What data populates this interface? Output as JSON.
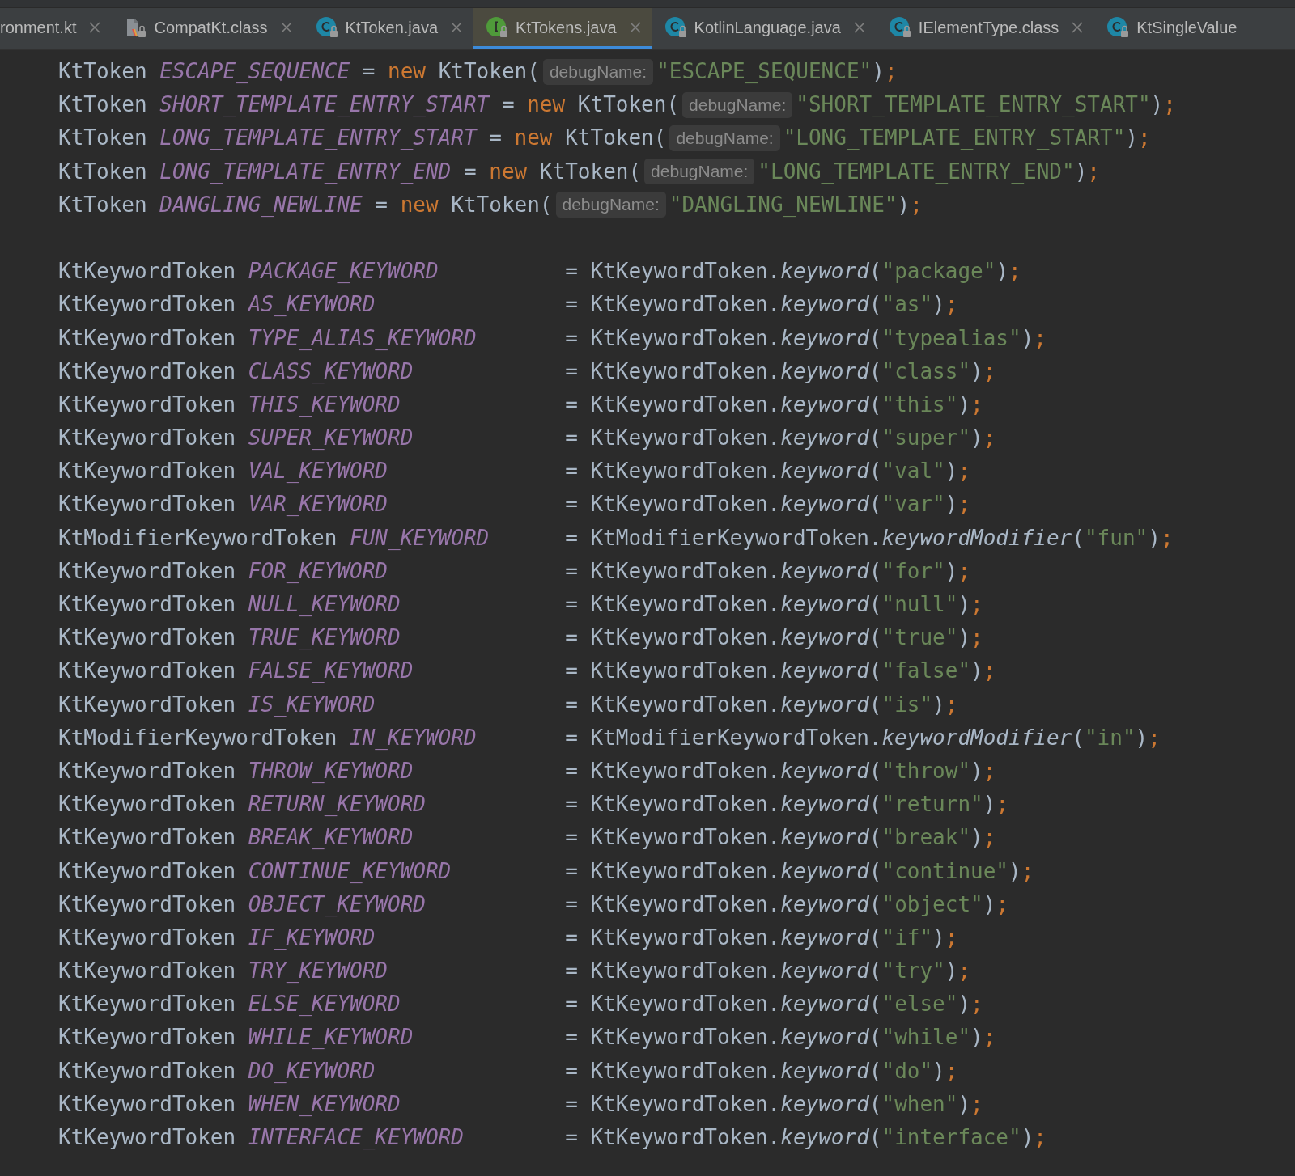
{
  "tabs": [
    {
      "label": "ronment.kt",
      "kind": "plain",
      "selected": false
    },
    {
      "label": "CompatKt.class",
      "kind": "compiled",
      "selected": false
    },
    {
      "label": "KtToken.java",
      "kind": "class",
      "selected": false
    },
    {
      "label": "KtTokens.java",
      "kind": "interface",
      "selected": true
    },
    {
      "label": "KotlinLanguage.java",
      "kind": "class",
      "selected": false
    },
    {
      "label": "IElementType.class",
      "kind": "class",
      "selected": false
    },
    {
      "label": "KtSingleValue",
      "kind": "class",
      "selected": false
    }
  ],
  "code_lines": [
    {
      "kind": "plain",
      "lhs": [
        {
          "kind": "type",
          "text": "KtToken "
        },
        {
          "kind": "field",
          "text": "ESCAPE_SEQUENCE"
        }
      ],
      "rhs": [
        {
          "kind": "op",
          "text": " = "
        },
        {
          "kind": "keyword",
          "text": "new "
        },
        {
          "kind": "type",
          "text": "KtToken("
        },
        {
          "kind": "hint",
          "text": "debugName:"
        },
        {
          "kind": "string",
          "text": "\"ESCAPE_SEQUENCE\""
        },
        {
          "kind": "type",
          "text": ")"
        },
        {
          "kind": "keyword",
          "text": ";"
        }
      ]
    },
    {
      "kind": "plain",
      "lhs": [
        {
          "kind": "type",
          "text": "KtToken "
        },
        {
          "kind": "field",
          "text": "SHORT_TEMPLATE_ENTRY_START"
        }
      ],
      "rhs": [
        {
          "kind": "op",
          "text": " = "
        },
        {
          "kind": "keyword",
          "text": "new "
        },
        {
          "kind": "type",
          "text": "KtToken("
        },
        {
          "kind": "hint",
          "text": "debugName:"
        },
        {
          "kind": "string",
          "text": "\"SHORT_TEMPLATE_ENTRY_START\""
        },
        {
          "kind": "type",
          "text": ")"
        },
        {
          "kind": "keyword",
          "text": ";"
        }
      ]
    },
    {
      "kind": "plain",
      "lhs": [
        {
          "kind": "type",
          "text": "KtToken "
        },
        {
          "kind": "field",
          "text": "LONG_TEMPLATE_ENTRY_START"
        }
      ],
      "rhs": [
        {
          "kind": "op",
          "text": " = "
        },
        {
          "kind": "keyword",
          "text": "new "
        },
        {
          "kind": "type",
          "text": "KtToken("
        },
        {
          "kind": "hint",
          "text": "debugName:"
        },
        {
          "kind": "string",
          "text": "\"LONG_TEMPLATE_ENTRY_START\""
        },
        {
          "kind": "type",
          "text": ")"
        },
        {
          "kind": "keyword",
          "text": ";"
        }
      ]
    },
    {
      "kind": "plain",
      "lhs": [
        {
          "kind": "type",
          "text": "KtToken "
        },
        {
          "kind": "field",
          "text": "LONG_TEMPLATE_ENTRY_END"
        }
      ],
      "rhs": [
        {
          "kind": "op",
          "text": " = "
        },
        {
          "kind": "keyword",
          "text": "new "
        },
        {
          "kind": "type",
          "text": "KtToken("
        },
        {
          "kind": "hint",
          "text": "debugName:"
        },
        {
          "kind": "string",
          "text": "\"LONG_TEMPLATE_ENTRY_END\""
        },
        {
          "kind": "type",
          "text": ")"
        },
        {
          "kind": "keyword",
          "text": ";"
        }
      ]
    },
    {
      "kind": "plain",
      "lhs": [
        {
          "kind": "type",
          "text": "KtToken "
        },
        {
          "kind": "field",
          "text": "DANGLING_NEWLINE"
        }
      ],
      "rhs": [
        {
          "kind": "op",
          "text": " = "
        },
        {
          "kind": "keyword",
          "text": "new "
        },
        {
          "kind": "type",
          "text": "KtToken("
        },
        {
          "kind": "hint",
          "text": "debugName:"
        },
        {
          "kind": "string",
          "text": "\"DANGLING_NEWLINE\""
        },
        {
          "kind": "type",
          "text": ")"
        },
        {
          "kind": "keyword",
          "text": ";"
        }
      ]
    },
    {
      "kind": "blank"
    },
    {
      "kind": "aligned",
      "lhs": [
        {
          "kind": "type",
          "text": "KtKeywordToken "
        },
        {
          "kind": "field",
          "text": "PACKAGE_KEYWORD"
        }
      ],
      "rhs": [
        {
          "kind": "op",
          "text": "= "
        },
        {
          "kind": "type",
          "text": "KtKeywordToken."
        },
        {
          "kind": "method",
          "text": "keyword"
        },
        {
          "kind": "type",
          "text": "("
        },
        {
          "kind": "string",
          "text": "\"package\""
        },
        {
          "kind": "type",
          "text": ")"
        },
        {
          "kind": "keyword",
          "text": ";"
        }
      ]
    },
    {
      "kind": "aligned",
      "lhs": [
        {
          "kind": "type",
          "text": "KtKeywordToken "
        },
        {
          "kind": "field",
          "text": "AS_KEYWORD"
        }
      ],
      "rhs": [
        {
          "kind": "op",
          "text": "= "
        },
        {
          "kind": "type",
          "text": "KtKeywordToken."
        },
        {
          "kind": "method",
          "text": "keyword"
        },
        {
          "kind": "type",
          "text": "("
        },
        {
          "kind": "string",
          "text": "\"as\""
        },
        {
          "kind": "type",
          "text": ")"
        },
        {
          "kind": "keyword",
          "text": ";"
        }
      ]
    },
    {
      "kind": "aligned",
      "lhs": [
        {
          "kind": "type",
          "text": "KtKeywordToken "
        },
        {
          "kind": "field",
          "text": "TYPE_ALIAS_KEYWORD"
        }
      ],
      "rhs": [
        {
          "kind": "op",
          "text": "= "
        },
        {
          "kind": "type",
          "text": "KtKeywordToken."
        },
        {
          "kind": "method",
          "text": "keyword"
        },
        {
          "kind": "type",
          "text": "("
        },
        {
          "kind": "string",
          "text": "\"typealias\""
        },
        {
          "kind": "type",
          "text": ")"
        },
        {
          "kind": "keyword",
          "text": ";"
        }
      ]
    },
    {
      "kind": "aligned",
      "lhs": [
        {
          "kind": "type",
          "text": "KtKeywordToken "
        },
        {
          "kind": "field",
          "text": "CLASS_KEYWORD"
        }
      ],
      "rhs": [
        {
          "kind": "op",
          "text": "= "
        },
        {
          "kind": "type",
          "text": "KtKeywordToken."
        },
        {
          "kind": "method",
          "text": "keyword"
        },
        {
          "kind": "type",
          "text": "("
        },
        {
          "kind": "string",
          "text": "\"class\""
        },
        {
          "kind": "type",
          "text": ")"
        },
        {
          "kind": "keyword",
          "text": ";"
        }
      ]
    },
    {
      "kind": "aligned",
      "lhs": [
        {
          "kind": "type",
          "text": "KtKeywordToken "
        },
        {
          "kind": "field",
          "text": "THIS_KEYWORD"
        }
      ],
      "rhs": [
        {
          "kind": "op",
          "text": "= "
        },
        {
          "kind": "type",
          "text": "KtKeywordToken."
        },
        {
          "kind": "method",
          "text": "keyword"
        },
        {
          "kind": "type",
          "text": "("
        },
        {
          "kind": "string",
          "text": "\"this\""
        },
        {
          "kind": "type",
          "text": ")"
        },
        {
          "kind": "keyword",
          "text": ";"
        }
      ]
    },
    {
      "kind": "aligned",
      "lhs": [
        {
          "kind": "type",
          "text": "KtKeywordToken "
        },
        {
          "kind": "field",
          "text": "SUPER_KEYWORD"
        }
      ],
      "rhs": [
        {
          "kind": "op",
          "text": "= "
        },
        {
          "kind": "type",
          "text": "KtKeywordToken."
        },
        {
          "kind": "method",
          "text": "keyword"
        },
        {
          "kind": "type",
          "text": "("
        },
        {
          "kind": "string",
          "text": "\"super\""
        },
        {
          "kind": "type",
          "text": ")"
        },
        {
          "kind": "keyword",
          "text": ";"
        }
      ]
    },
    {
      "kind": "aligned",
      "lhs": [
        {
          "kind": "type",
          "text": "KtKeywordToken "
        },
        {
          "kind": "field",
          "text": "VAL_KEYWORD"
        }
      ],
      "rhs": [
        {
          "kind": "op",
          "text": "= "
        },
        {
          "kind": "type",
          "text": "KtKeywordToken."
        },
        {
          "kind": "method",
          "text": "keyword"
        },
        {
          "kind": "type",
          "text": "("
        },
        {
          "kind": "string",
          "text": "\"val\""
        },
        {
          "kind": "type",
          "text": ")"
        },
        {
          "kind": "keyword",
          "text": ";"
        }
      ]
    },
    {
      "kind": "aligned",
      "lhs": [
        {
          "kind": "type",
          "text": "KtKeywordToken "
        },
        {
          "kind": "field",
          "text": "VAR_KEYWORD"
        }
      ],
      "rhs": [
        {
          "kind": "op",
          "text": "= "
        },
        {
          "kind": "type",
          "text": "KtKeywordToken."
        },
        {
          "kind": "method",
          "text": "keyword"
        },
        {
          "kind": "type",
          "text": "("
        },
        {
          "kind": "string",
          "text": "\"var\""
        },
        {
          "kind": "type",
          "text": ")"
        },
        {
          "kind": "keyword",
          "text": ";"
        }
      ]
    },
    {
      "kind": "aligned",
      "lhs": [
        {
          "kind": "type",
          "text": "KtModifierKeywordToken "
        },
        {
          "kind": "field",
          "text": "FUN_KEYWORD"
        }
      ],
      "rhs": [
        {
          "kind": "op",
          "text": "= "
        },
        {
          "kind": "type",
          "text": "KtModifierKeywordToken."
        },
        {
          "kind": "method",
          "text": "keywordModifier"
        },
        {
          "kind": "type",
          "text": "("
        },
        {
          "kind": "string",
          "text": "\"fun\""
        },
        {
          "kind": "type",
          "text": ")"
        },
        {
          "kind": "keyword",
          "text": ";"
        }
      ]
    },
    {
      "kind": "aligned",
      "lhs": [
        {
          "kind": "type",
          "text": "KtKeywordToken "
        },
        {
          "kind": "field",
          "text": "FOR_KEYWORD"
        }
      ],
      "rhs": [
        {
          "kind": "op",
          "text": "= "
        },
        {
          "kind": "type",
          "text": "KtKeywordToken."
        },
        {
          "kind": "method",
          "text": "keyword"
        },
        {
          "kind": "type",
          "text": "("
        },
        {
          "kind": "string",
          "text": "\"for\""
        },
        {
          "kind": "type",
          "text": ")"
        },
        {
          "kind": "keyword",
          "text": ";"
        }
      ]
    },
    {
      "kind": "aligned",
      "lhs": [
        {
          "kind": "type",
          "text": "KtKeywordToken "
        },
        {
          "kind": "field",
          "text": "NULL_KEYWORD"
        }
      ],
      "rhs": [
        {
          "kind": "op",
          "text": "= "
        },
        {
          "kind": "type",
          "text": "KtKeywordToken."
        },
        {
          "kind": "method",
          "text": "keyword"
        },
        {
          "kind": "type",
          "text": "("
        },
        {
          "kind": "string",
          "text": "\"null\""
        },
        {
          "kind": "type",
          "text": ")"
        },
        {
          "kind": "keyword",
          "text": ";"
        }
      ]
    },
    {
      "kind": "aligned",
      "lhs": [
        {
          "kind": "type",
          "text": "KtKeywordToken "
        },
        {
          "kind": "field",
          "text": "TRUE_KEYWORD"
        }
      ],
      "rhs": [
        {
          "kind": "op",
          "text": "= "
        },
        {
          "kind": "type",
          "text": "KtKeywordToken."
        },
        {
          "kind": "method",
          "text": "keyword"
        },
        {
          "kind": "type",
          "text": "("
        },
        {
          "kind": "string",
          "text": "\"true\""
        },
        {
          "kind": "type",
          "text": ")"
        },
        {
          "kind": "keyword",
          "text": ";"
        }
      ]
    },
    {
      "kind": "aligned",
      "lhs": [
        {
          "kind": "type",
          "text": "KtKeywordToken "
        },
        {
          "kind": "field",
          "text": "FALSE_KEYWORD"
        }
      ],
      "rhs": [
        {
          "kind": "op",
          "text": "= "
        },
        {
          "kind": "type",
          "text": "KtKeywordToken."
        },
        {
          "kind": "method",
          "text": "keyword"
        },
        {
          "kind": "type",
          "text": "("
        },
        {
          "kind": "string",
          "text": "\"false\""
        },
        {
          "kind": "type",
          "text": ")"
        },
        {
          "kind": "keyword",
          "text": ";"
        }
      ]
    },
    {
      "kind": "aligned",
      "lhs": [
        {
          "kind": "type",
          "text": "KtKeywordToken "
        },
        {
          "kind": "field",
          "text": "IS_KEYWORD"
        }
      ],
      "rhs": [
        {
          "kind": "op",
          "text": "= "
        },
        {
          "kind": "type",
          "text": "KtKeywordToken."
        },
        {
          "kind": "method",
          "text": "keyword"
        },
        {
          "kind": "type",
          "text": "("
        },
        {
          "kind": "string",
          "text": "\"is\""
        },
        {
          "kind": "type",
          "text": ")"
        },
        {
          "kind": "keyword",
          "text": ";"
        }
      ]
    },
    {
      "kind": "aligned",
      "lhs": [
        {
          "kind": "type",
          "text": "KtModifierKeywordToken "
        },
        {
          "kind": "field",
          "text": "IN_KEYWORD"
        }
      ],
      "rhs": [
        {
          "kind": "op",
          "text": "= "
        },
        {
          "kind": "type",
          "text": "KtModifierKeywordToken."
        },
        {
          "kind": "method",
          "text": "keywordModifier"
        },
        {
          "kind": "type",
          "text": "("
        },
        {
          "kind": "string",
          "text": "\"in\""
        },
        {
          "kind": "type",
          "text": ")"
        },
        {
          "kind": "keyword",
          "text": ";"
        }
      ]
    },
    {
      "kind": "aligned",
      "lhs": [
        {
          "kind": "type",
          "text": "KtKeywordToken "
        },
        {
          "kind": "field",
          "text": "THROW_KEYWORD"
        }
      ],
      "rhs": [
        {
          "kind": "op",
          "text": "= "
        },
        {
          "kind": "type",
          "text": "KtKeywordToken."
        },
        {
          "kind": "method",
          "text": "keyword"
        },
        {
          "kind": "type",
          "text": "("
        },
        {
          "kind": "string",
          "text": "\"throw\""
        },
        {
          "kind": "type",
          "text": ")"
        },
        {
          "kind": "keyword",
          "text": ";"
        }
      ]
    },
    {
      "kind": "aligned",
      "lhs": [
        {
          "kind": "type",
          "text": "KtKeywordToken "
        },
        {
          "kind": "field",
          "text": "RETURN_KEYWORD"
        }
      ],
      "rhs": [
        {
          "kind": "op",
          "text": "= "
        },
        {
          "kind": "type",
          "text": "KtKeywordToken."
        },
        {
          "kind": "method",
          "text": "keyword"
        },
        {
          "kind": "type",
          "text": "("
        },
        {
          "kind": "string",
          "text": "\"return\""
        },
        {
          "kind": "type",
          "text": ")"
        },
        {
          "kind": "keyword",
          "text": ";"
        }
      ]
    },
    {
      "kind": "aligned",
      "lhs": [
        {
          "kind": "type",
          "text": "KtKeywordToken "
        },
        {
          "kind": "field",
          "text": "BREAK_KEYWORD"
        }
      ],
      "rhs": [
        {
          "kind": "op",
          "text": "= "
        },
        {
          "kind": "type",
          "text": "KtKeywordToken."
        },
        {
          "kind": "method",
          "text": "keyword"
        },
        {
          "kind": "type",
          "text": "("
        },
        {
          "kind": "string",
          "text": "\"break\""
        },
        {
          "kind": "type",
          "text": ")"
        },
        {
          "kind": "keyword",
          "text": ";"
        }
      ]
    },
    {
      "kind": "aligned",
      "lhs": [
        {
          "kind": "type",
          "text": "KtKeywordToken "
        },
        {
          "kind": "field",
          "text": "CONTINUE_KEYWORD"
        }
      ],
      "rhs": [
        {
          "kind": "op",
          "text": "= "
        },
        {
          "kind": "type",
          "text": "KtKeywordToken."
        },
        {
          "kind": "method",
          "text": "keyword"
        },
        {
          "kind": "type",
          "text": "("
        },
        {
          "kind": "string",
          "text": "\"continue\""
        },
        {
          "kind": "type",
          "text": ")"
        },
        {
          "kind": "keyword",
          "text": ";"
        }
      ]
    },
    {
      "kind": "aligned",
      "lhs": [
        {
          "kind": "type",
          "text": "KtKeywordToken "
        },
        {
          "kind": "field",
          "text": "OBJECT_KEYWORD"
        }
      ],
      "rhs": [
        {
          "kind": "op",
          "text": "= "
        },
        {
          "kind": "type",
          "text": "KtKeywordToken."
        },
        {
          "kind": "method",
          "text": "keyword"
        },
        {
          "kind": "type",
          "text": "("
        },
        {
          "kind": "string",
          "text": "\"object\""
        },
        {
          "kind": "type",
          "text": ")"
        },
        {
          "kind": "keyword",
          "text": ";"
        }
      ]
    },
    {
      "kind": "aligned",
      "lhs": [
        {
          "kind": "type",
          "text": "KtKeywordToken "
        },
        {
          "kind": "field",
          "text": "IF_KEYWORD"
        }
      ],
      "rhs": [
        {
          "kind": "op",
          "text": "= "
        },
        {
          "kind": "type",
          "text": "KtKeywordToken."
        },
        {
          "kind": "method",
          "text": "keyword"
        },
        {
          "kind": "type",
          "text": "("
        },
        {
          "kind": "string",
          "text": "\"if\""
        },
        {
          "kind": "type",
          "text": ")"
        },
        {
          "kind": "keyword",
          "text": ";"
        }
      ]
    },
    {
      "kind": "aligned",
      "lhs": [
        {
          "kind": "type",
          "text": "KtKeywordToken "
        },
        {
          "kind": "field",
          "text": "TRY_KEYWORD"
        }
      ],
      "rhs": [
        {
          "kind": "op",
          "text": "= "
        },
        {
          "kind": "type",
          "text": "KtKeywordToken."
        },
        {
          "kind": "method",
          "text": "keyword"
        },
        {
          "kind": "type",
          "text": "("
        },
        {
          "kind": "string",
          "text": "\"try\""
        },
        {
          "kind": "type",
          "text": ")"
        },
        {
          "kind": "keyword",
          "text": ";"
        }
      ]
    },
    {
      "kind": "aligned",
      "lhs": [
        {
          "kind": "type",
          "text": "KtKeywordToken "
        },
        {
          "kind": "field",
          "text": "ELSE_KEYWORD"
        }
      ],
      "rhs": [
        {
          "kind": "op",
          "text": "= "
        },
        {
          "kind": "type",
          "text": "KtKeywordToken."
        },
        {
          "kind": "method",
          "text": "keyword"
        },
        {
          "kind": "type",
          "text": "("
        },
        {
          "kind": "string",
          "text": "\"else\""
        },
        {
          "kind": "type",
          "text": ")"
        },
        {
          "kind": "keyword",
          "text": ";"
        }
      ]
    },
    {
      "kind": "aligned",
      "lhs": [
        {
          "kind": "type",
          "text": "KtKeywordToken "
        },
        {
          "kind": "field",
          "text": "WHILE_KEYWORD"
        }
      ],
      "rhs": [
        {
          "kind": "op",
          "text": "= "
        },
        {
          "kind": "type",
          "text": "KtKeywordToken."
        },
        {
          "kind": "method",
          "text": "keyword"
        },
        {
          "kind": "type",
          "text": "("
        },
        {
          "kind": "string",
          "text": "\"while\""
        },
        {
          "kind": "type",
          "text": ")"
        },
        {
          "kind": "keyword",
          "text": ";"
        }
      ]
    },
    {
      "kind": "aligned",
      "lhs": [
        {
          "kind": "type",
          "text": "KtKeywordToken "
        },
        {
          "kind": "field",
          "text": "DO_KEYWORD"
        }
      ],
      "rhs": [
        {
          "kind": "op",
          "text": "= "
        },
        {
          "kind": "type",
          "text": "KtKeywordToken."
        },
        {
          "kind": "method",
          "text": "keyword"
        },
        {
          "kind": "type",
          "text": "("
        },
        {
          "kind": "string",
          "text": "\"do\""
        },
        {
          "kind": "type",
          "text": ")"
        },
        {
          "kind": "keyword",
          "text": ";"
        }
      ]
    },
    {
      "kind": "aligned",
      "lhs": [
        {
          "kind": "type",
          "text": "KtKeywordToken "
        },
        {
          "kind": "field",
          "text": "WHEN_KEYWORD"
        }
      ],
      "rhs": [
        {
          "kind": "op",
          "text": "= "
        },
        {
          "kind": "type",
          "text": "KtKeywordToken."
        },
        {
          "kind": "method",
          "text": "keyword"
        },
        {
          "kind": "type",
          "text": "("
        },
        {
          "kind": "string",
          "text": "\"when\""
        },
        {
          "kind": "type",
          "text": ")"
        },
        {
          "kind": "keyword",
          "text": ";"
        }
      ]
    },
    {
      "kind": "aligned",
      "lhs": [
        {
          "kind": "type",
          "text": "KtKeywordToken "
        },
        {
          "kind": "field",
          "text": "INTERFACE_KEYWORD"
        }
      ],
      "rhs": [
        {
          "kind": "op",
          "text": "= "
        },
        {
          "kind": "type",
          "text": "KtKeywordToken."
        },
        {
          "kind": "method",
          "text": "keyword"
        },
        {
          "kind": "type",
          "text": "("
        },
        {
          "kind": "string",
          "text": "\"interface\""
        },
        {
          "kind": "type",
          "text": ")"
        },
        {
          "kind": "keyword",
          "text": ";"
        }
      ]
    }
  ]
}
